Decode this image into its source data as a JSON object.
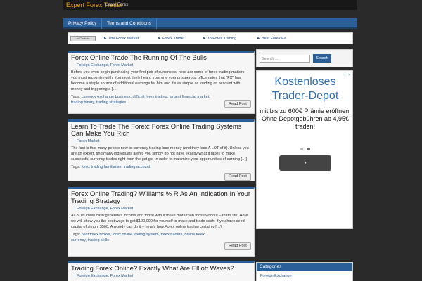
{
  "header": {
    "site_title": "Expert Forex Trader",
    "tagline": "Learn Forex"
  },
  "nav": {
    "items": [
      "Privacy Policy",
      "Terms and Conditions"
    ]
  },
  "ad_strip": {
    "adchoices": "AdChoices",
    "links": [
      "► The Forex Market",
      "► Forex Trader",
      "► To Forex Trading",
      "► Best Forex Ea"
    ]
  },
  "posts": [
    {
      "title": "Forex Online Trade The Running Of The Bulls",
      "categories": "Foreign Exchange, Forex Market",
      "excerpt": "Before you even begin purchasing your first pair of currencies, here are some of forex trading matters you must recognize with. You most likely heard from one your prosperous officemates that \"FX\" has become a staple source of additional earnings for him and it's as simple as loading an account with money and triggering a […]",
      "tags_label": "Tags:",
      "tags": "currency exchange business, difficult forex trading, largest financial market, trading binary, trading strategies",
      "read_label": "Read Post"
    },
    {
      "title": "Learn To Trade The Forex: Forex Online Trading Systems Can Make You Rich",
      "categories": "Forex Market",
      "excerpt": "The fact is that many people new to currency trading lose money (and they lose A LOT of it). Unless you are an expert, and many individuals aren't, you simply do not have exactly what it takes to make successful currency trades right from the get go. In order to maximize your opportunities of earning […]",
      "tags_label": "Tags:",
      "tags": "forex trading familiarise, trading account",
      "read_label": "Read Post"
    },
    {
      "title": "Forex Online Trading? Williams % R As An Indication In Your Trading Strategy",
      "categories": "Foreign Exchange, Forex Market",
      "excerpt": "All of us know cash generates income and those with it make more than those without – that's life. Here we will show you the best ways to get $100,000 for yourself to make and trade cash, if you have seed capital of simply $500. Anybody can do it – here's how.Forex online trading certainly […]",
      "tags_label": "Tags:",
      "tags": "best forex broker, forex online trading system, forex traders, online forex currency, trading skills",
      "read_label": "Read Post"
    },
    {
      "title": "Trading Forex Online? Exactly What Are Elliott Waves?",
      "categories": "Foreign Exchange, Forex Market"
    }
  ],
  "sidebar": {
    "search_placeholder": "Search ...",
    "search_button": "Search",
    "ad": {
      "headline": "Kostenloses Trader-Depot",
      "body": "mit bis zu 600€ Prämie eröffnen. Ohne Depotgebühren ab 4,95€ traden!",
      "next_glyph": "›",
      "info_icons": "ⓘ ✕"
    },
    "categories_title": "Categories",
    "categories_first": "Foreign Exchange"
  },
  "colors": {
    "accent": "#2b5f97",
    "brand": "#f0a000",
    "ad_headline": "#2d6fb6"
  }
}
